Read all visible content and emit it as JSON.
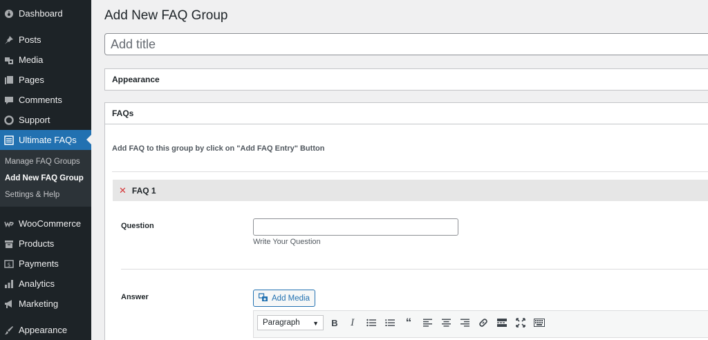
{
  "sidebar": {
    "items": [
      {
        "label": "Dashboard",
        "icon": "dashboard-icon"
      },
      {
        "label": "Posts",
        "icon": "pin-icon"
      },
      {
        "label": "Media",
        "icon": "media-icon"
      },
      {
        "label": "Pages",
        "icon": "pages-icon"
      },
      {
        "label": "Comments",
        "icon": "comment-icon"
      },
      {
        "label": "Support",
        "icon": "lifebuoy-icon"
      },
      {
        "label": "Ultimate FAQs",
        "icon": "list-icon",
        "active": true
      },
      {
        "label": "WooCommerce",
        "icon": "woo-icon"
      },
      {
        "label": "Products",
        "icon": "archive-icon"
      },
      {
        "label": "Payments",
        "icon": "dollar-icon"
      },
      {
        "label": "Analytics",
        "icon": "bar-chart-icon"
      },
      {
        "label": "Marketing",
        "icon": "megaphone-icon"
      },
      {
        "label": "Appearance",
        "icon": "brush-icon"
      }
    ],
    "submenu": [
      {
        "label": "Manage FAQ Groups"
      },
      {
        "label": "Add New FAQ Group",
        "current": true
      },
      {
        "label": "Settings & Help"
      }
    ]
  },
  "main": {
    "page_title": "Add New FAQ Group",
    "title_placeholder": "Add title",
    "appearance_box": {
      "title": "Appearance"
    },
    "faqs_box": {
      "title": "FAQs",
      "instructions": "Add FAQ to this group by click on \"Add FAQ Entry\" Button",
      "faq": {
        "title": "FAQ 1",
        "remove_glyph": "✕",
        "question_label": "Question",
        "question_value": "",
        "question_description": "Write Your Question",
        "answer_label": "Answer",
        "add_media_label": "Add Media",
        "format_select": "Paragraph"
      }
    }
  },
  "colors": {
    "sidebar_bg": "#1d2327",
    "submenu_bg": "#2c3338",
    "accent": "#2271b1",
    "remove": "#d63638",
    "page_bg": "#f0f0f1"
  }
}
